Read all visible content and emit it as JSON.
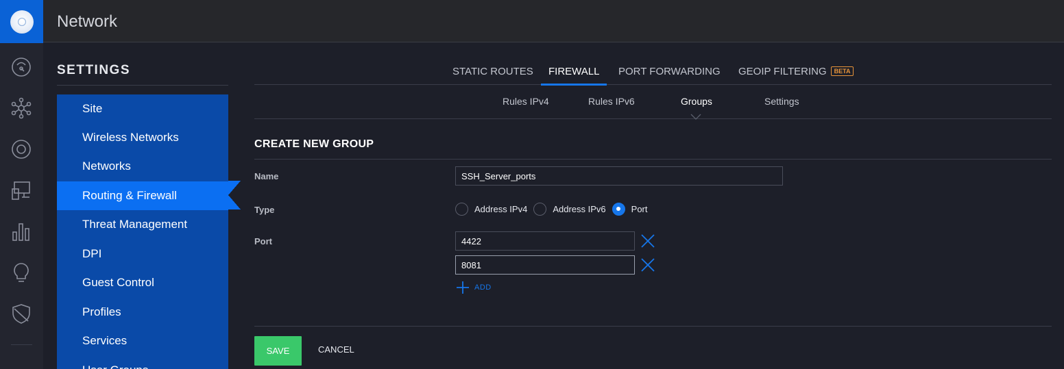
{
  "app": {
    "title": "Network"
  },
  "rail": {
    "icons": [
      "dashboard-icon",
      "topology-icon",
      "devices-icon",
      "clients-icon",
      "statistics-icon",
      "insights-icon",
      "alerts-icon"
    ]
  },
  "settings": {
    "heading": "SETTINGS",
    "items": [
      {
        "label": "Site"
      },
      {
        "label": "Wireless Networks"
      },
      {
        "label": "Networks"
      },
      {
        "label": "Routing & Firewall"
      },
      {
        "label": "Threat Management"
      },
      {
        "label": "DPI"
      },
      {
        "label": "Guest Control"
      },
      {
        "label": "Profiles"
      },
      {
        "label": "Services"
      },
      {
        "label": "User Groups"
      }
    ],
    "active_item": "Routing & Firewall"
  },
  "main_tabs": [
    {
      "label": "STATIC ROUTES"
    },
    {
      "label": "FIREWALL"
    },
    {
      "label": "PORT FORWARDING"
    },
    {
      "label": "GEOIP FILTERING",
      "badge": "BETA"
    }
  ],
  "sub_tabs": [
    {
      "label": "Rules IPv4"
    },
    {
      "label": "Rules IPv6"
    },
    {
      "label": "Groups"
    },
    {
      "label": "Settings"
    }
  ],
  "form": {
    "title": "CREATE NEW GROUP",
    "name_label": "Name",
    "name_value": "SSH_Server_ports",
    "type_label": "Type",
    "type_options": [
      "Address IPv4",
      "Address IPv6",
      "Port"
    ],
    "type_selected": "Port",
    "port_label": "Port",
    "ports": [
      "4422",
      "8081"
    ],
    "add_label": "ADD",
    "save_label": "SAVE",
    "cancel_label": "CANCEL"
  },
  "colors": {
    "accent": "#1676ea",
    "sidebar": "#0a4aa8",
    "sidebar_active": "#0b6ff2",
    "save": "#3ac86a",
    "beta": "#e8943a"
  }
}
